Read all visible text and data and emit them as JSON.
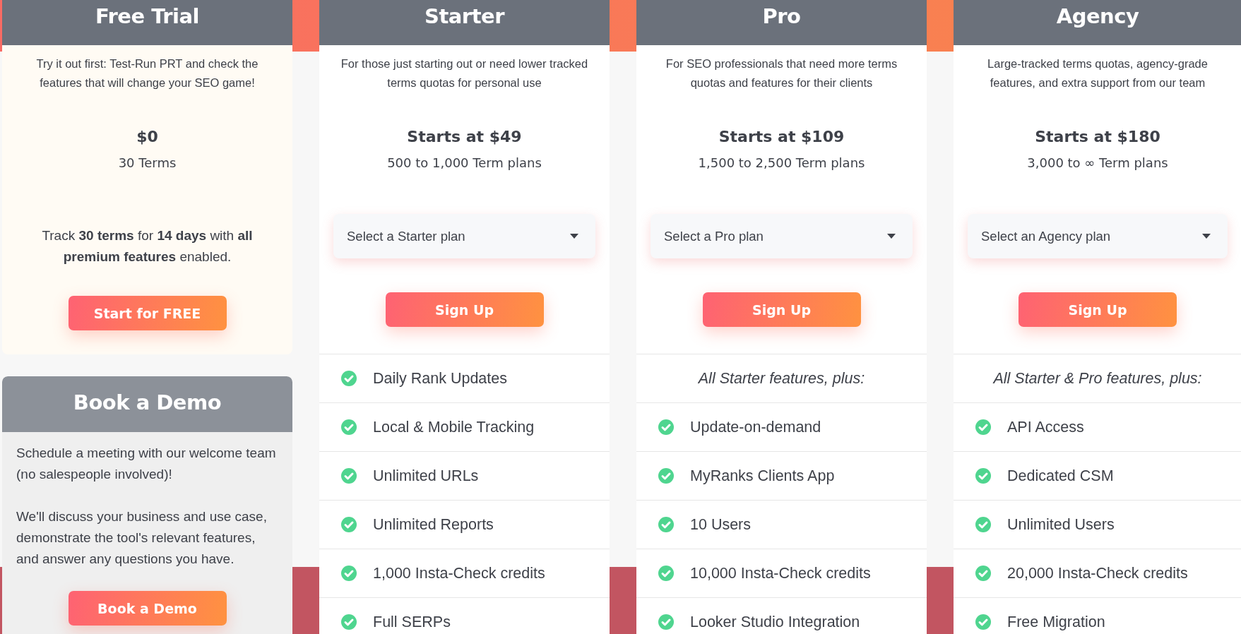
{
  "free_trial": {
    "title": "Free Trial",
    "description": "Try it out first: Test-Run PRT and check the features that will change your SEO game!",
    "price": "$0",
    "terms": "30 Terms",
    "details": "Track **30 terms** for **14 days** with **all premium features** enabled.",
    "button": "Start for FREE"
  },
  "demo": {
    "title": "Book a Demo",
    "paragraphs": [
      "Schedule a meeting with our welcome team (no salespeople involved)!",
      "We'll discuss your business and use case, demonstrate the tool's relevant features, and answer any questions you have."
    ],
    "button": "Book a Demo"
  },
  "plans": [
    {
      "title": "Starter",
      "description": "For those just starting out or need lower tracked terms quotas for personal use",
      "price": "Starts at $49",
      "terms": "500 to 1,000 Term plans",
      "select": {
        "placeholder": "Select a Starter plan"
      },
      "button": "Sign Up",
      "features": [
        "Daily Rank Updates",
        "Local & Mobile Tracking",
        "Unlimited URLs",
        "Unlimited Reports",
        "1,000 Insta-Check credits",
        "Full SERPs"
      ]
    },
    {
      "title": "Pro",
      "description": "For SEO professionals that need more terms quotas and features for their clients",
      "price": "Starts at $109",
      "terms": "1,500 to 2,500 Term plans",
      "select": {
        "placeholder": "Select a Pro plan"
      },
      "button": "Sign Up",
      "features_intro": "All Starter features, plus:",
      "features": [
        "Update-on-demand",
        "MyRanks Clients App",
        "10 Users",
        "10,000 Insta-Check credits",
        "Looker Studio Integration"
      ]
    },
    {
      "title": "Agency",
      "description": "Large-tracked terms quotas, agency-grade features, and extra support from our team",
      "price": "Starts at $180",
      "terms": "3,000 to ∞ Term plans",
      "select": {
        "placeholder": "Select an Agency plan"
      },
      "button": "Sign Up",
      "features_intro": "All Starter & Pro features, plus:",
      "features": [
        "API Access",
        "Dedicated CSM",
        "Unlimited Users",
        "20,000 Insta-Check credits",
        "Free Migration"
      ]
    }
  ]
}
